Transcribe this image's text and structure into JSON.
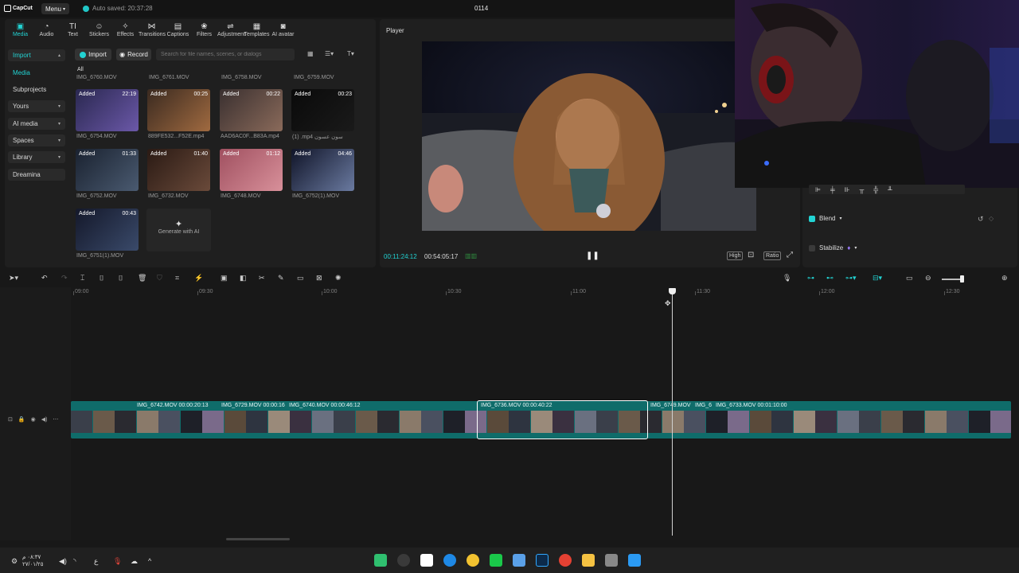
{
  "topbar": {
    "logo": "CapCut",
    "menu": "Menu",
    "autosave": "Auto saved: 20:37:28",
    "project": "0114"
  },
  "tools": [
    {
      "icon": "media-icon",
      "glyph": "▣",
      "label": "Media"
    },
    {
      "icon": "audio-icon",
      "glyph": "◔",
      "label": "Audio"
    },
    {
      "icon": "text-icon",
      "glyph": "TI",
      "label": "Text"
    },
    {
      "icon": "stickers-icon",
      "glyph": "☺",
      "label": "Stickers"
    },
    {
      "icon": "effects-icon",
      "glyph": "✧",
      "label": "Effects"
    },
    {
      "icon": "transitions-icon",
      "glyph": "⋈",
      "label": "Transitions"
    },
    {
      "icon": "captions-icon",
      "glyph": "▤",
      "label": "Captions"
    },
    {
      "icon": "filters-icon",
      "glyph": "❀",
      "label": "Filters"
    },
    {
      "icon": "adjustment-icon",
      "glyph": "⇌",
      "label": "Adjustment"
    },
    {
      "icon": "templates-icon",
      "glyph": "▦",
      "label": "Templates"
    },
    {
      "icon": "ai-avatar-icon",
      "glyph": "◙",
      "label": "AI avatar"
    }
  ],
  "sidebar": [
    {
      "label": "Import",
      "chev": "▴"
    },
    {
      "label": "Media",
      "chev": ""
    },
    {
      "label": "Subprojects",
      "chev": ""
    },
    {
      "label": "Yours",
      "chev": "▾"
    },
    {
      "label": "AI media",
      "chev": "▾"
    },
    {
      "label": "Spaces",
      "chev": "▾"
    },
    {
      "label": "Library",
      "chev": "▾"
    },
    {
      "label": "Dreamina",
      "chev": ""
    }
  ],
  "media": {
    "import": "Import",
    "record": "Record",
    "search_placeholder": "Search for file names, scenes, or dialogs",
    "filter_all": "All",
    "header_names": [
      "IMG_6760.MOV",
      "IMG_6761.MOV",
      "IMG_6758.MOV",
      "IMG_6759.MOV"
    ],
    "added": "Added",
    "items": [
      {
        "name": "IMG_6754.MOV",
        "dur": "22:19"
      },
      {
        "name": "889FE532...F52E.mp4",
        "dur": "00:25"
      },
      {
        "name": "AAD6AC0F...B83A.mp4",
        "dur": "00:22"
      },
      {
        "name": "(1) .mp4 سون عسون",
        "dur": "00:23"
      },
      {
        "name": "IMG_6752.MOV",
        "dur": "01:33"
      },
      {
        "name": "IMG_6732.MOV",
        "dur": "01:40"
      },
      {
        "name": "IMG_6748.MOV",
        "dur": "01:12"
      },
      {
        "name": "IMG_6752(1).MOV",
        "dur": "04:46"
      },
      {
        "name": "IMG_6751(1).MOV",
        "dur": "00:43"
      }
    ],
    "generate_ai": "Generate with AI"
  },
  "player": {
    "title": "Player",
    "current": "00:11:24:12",
    "total": "00:54:05:17",
    "quality": "High",
    "ratio": "Ratio"
  },
  "right": {
    "blend": "Blend",
    "stabilize": "Stabilize"
  },
  "ruler": [
    "09:00",
    "09:30",
    "10:00",
    "10:30",
    "11:00",
    "11:30",
    "12:00",
    "12:30"
  ],
  "clips": [
    {
      "label": "IMG_6742.MOV  00:00:20:13"
    },
    {
      "label": "IMG_6729.MOV  00:00:16"
    },
    {
      "label": "IMG_6740.MOV  00:00:46:12"
    },
    {
      "label": "IMG_6736.MOV  00:00:40:22"
    },
    {
      "label": "IMG_6749.MOV"
    },
    {
      "label": "IMG_6"
    },
    {
      "label": "IMG_6733.MOV  00:01:10:00"
    }
  ],
  "taskbar": {
    "time": "٠٨:٣٧ م",
    "date": "٢٧/٠١/٢٥"
  }
}
